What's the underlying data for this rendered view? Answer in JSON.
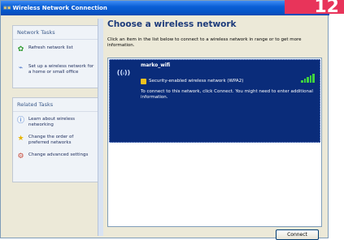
{
  "window": {
    "title": "Wireless Network Connection",
    "icon": "network-icon"
  },
  "badge": {
    "text": "12"
  },
  "network_tasks": {
    "title": "Network Tasks",
    "items": [
      {
        "label": "Refresh network list",
        "icon": "refresh-icon"
      },
      {
        "label": "Set up a wireless network for a home or small office",
        "icon": "setup-network-icon"
      }
    ]
  },
  "related_tasks": {
    "title": "Related Tasks",
    "items": [
      {
        "label": "Learn about wireless networking",
        "icon": "info-icon"
      },
      {
        "label": "Change the order of preferred networks",
        "icon": "star-icon"
      },
      {
        "label": "Change advanced settings",
        "icon": "settings-icon"
      }
    ]
  },
  "main": {
    "heading": "Choose a wireless network",
    "instructions": "Click an item in the list below to connect to a wireless network in range or to get more information."
  },
  "network": {
    "name": "marko_wifi",
    "security": "Security-enabled wireless network (WPA2)",
    "message": "To connect to this network, click Connect. You might need to enter additional information.",
    "signal_strength": 1.0,
    "signal_color": "#3fd23f"
  },
  "buttons": {
    "connect": "Connect"
  },
  "colors": {
    "selection": "#0a2c7a",
    "titlebar": "#0553c6",
    "badge": "#e8345a",
    "heading": "#1c3a7a"
  }
}
